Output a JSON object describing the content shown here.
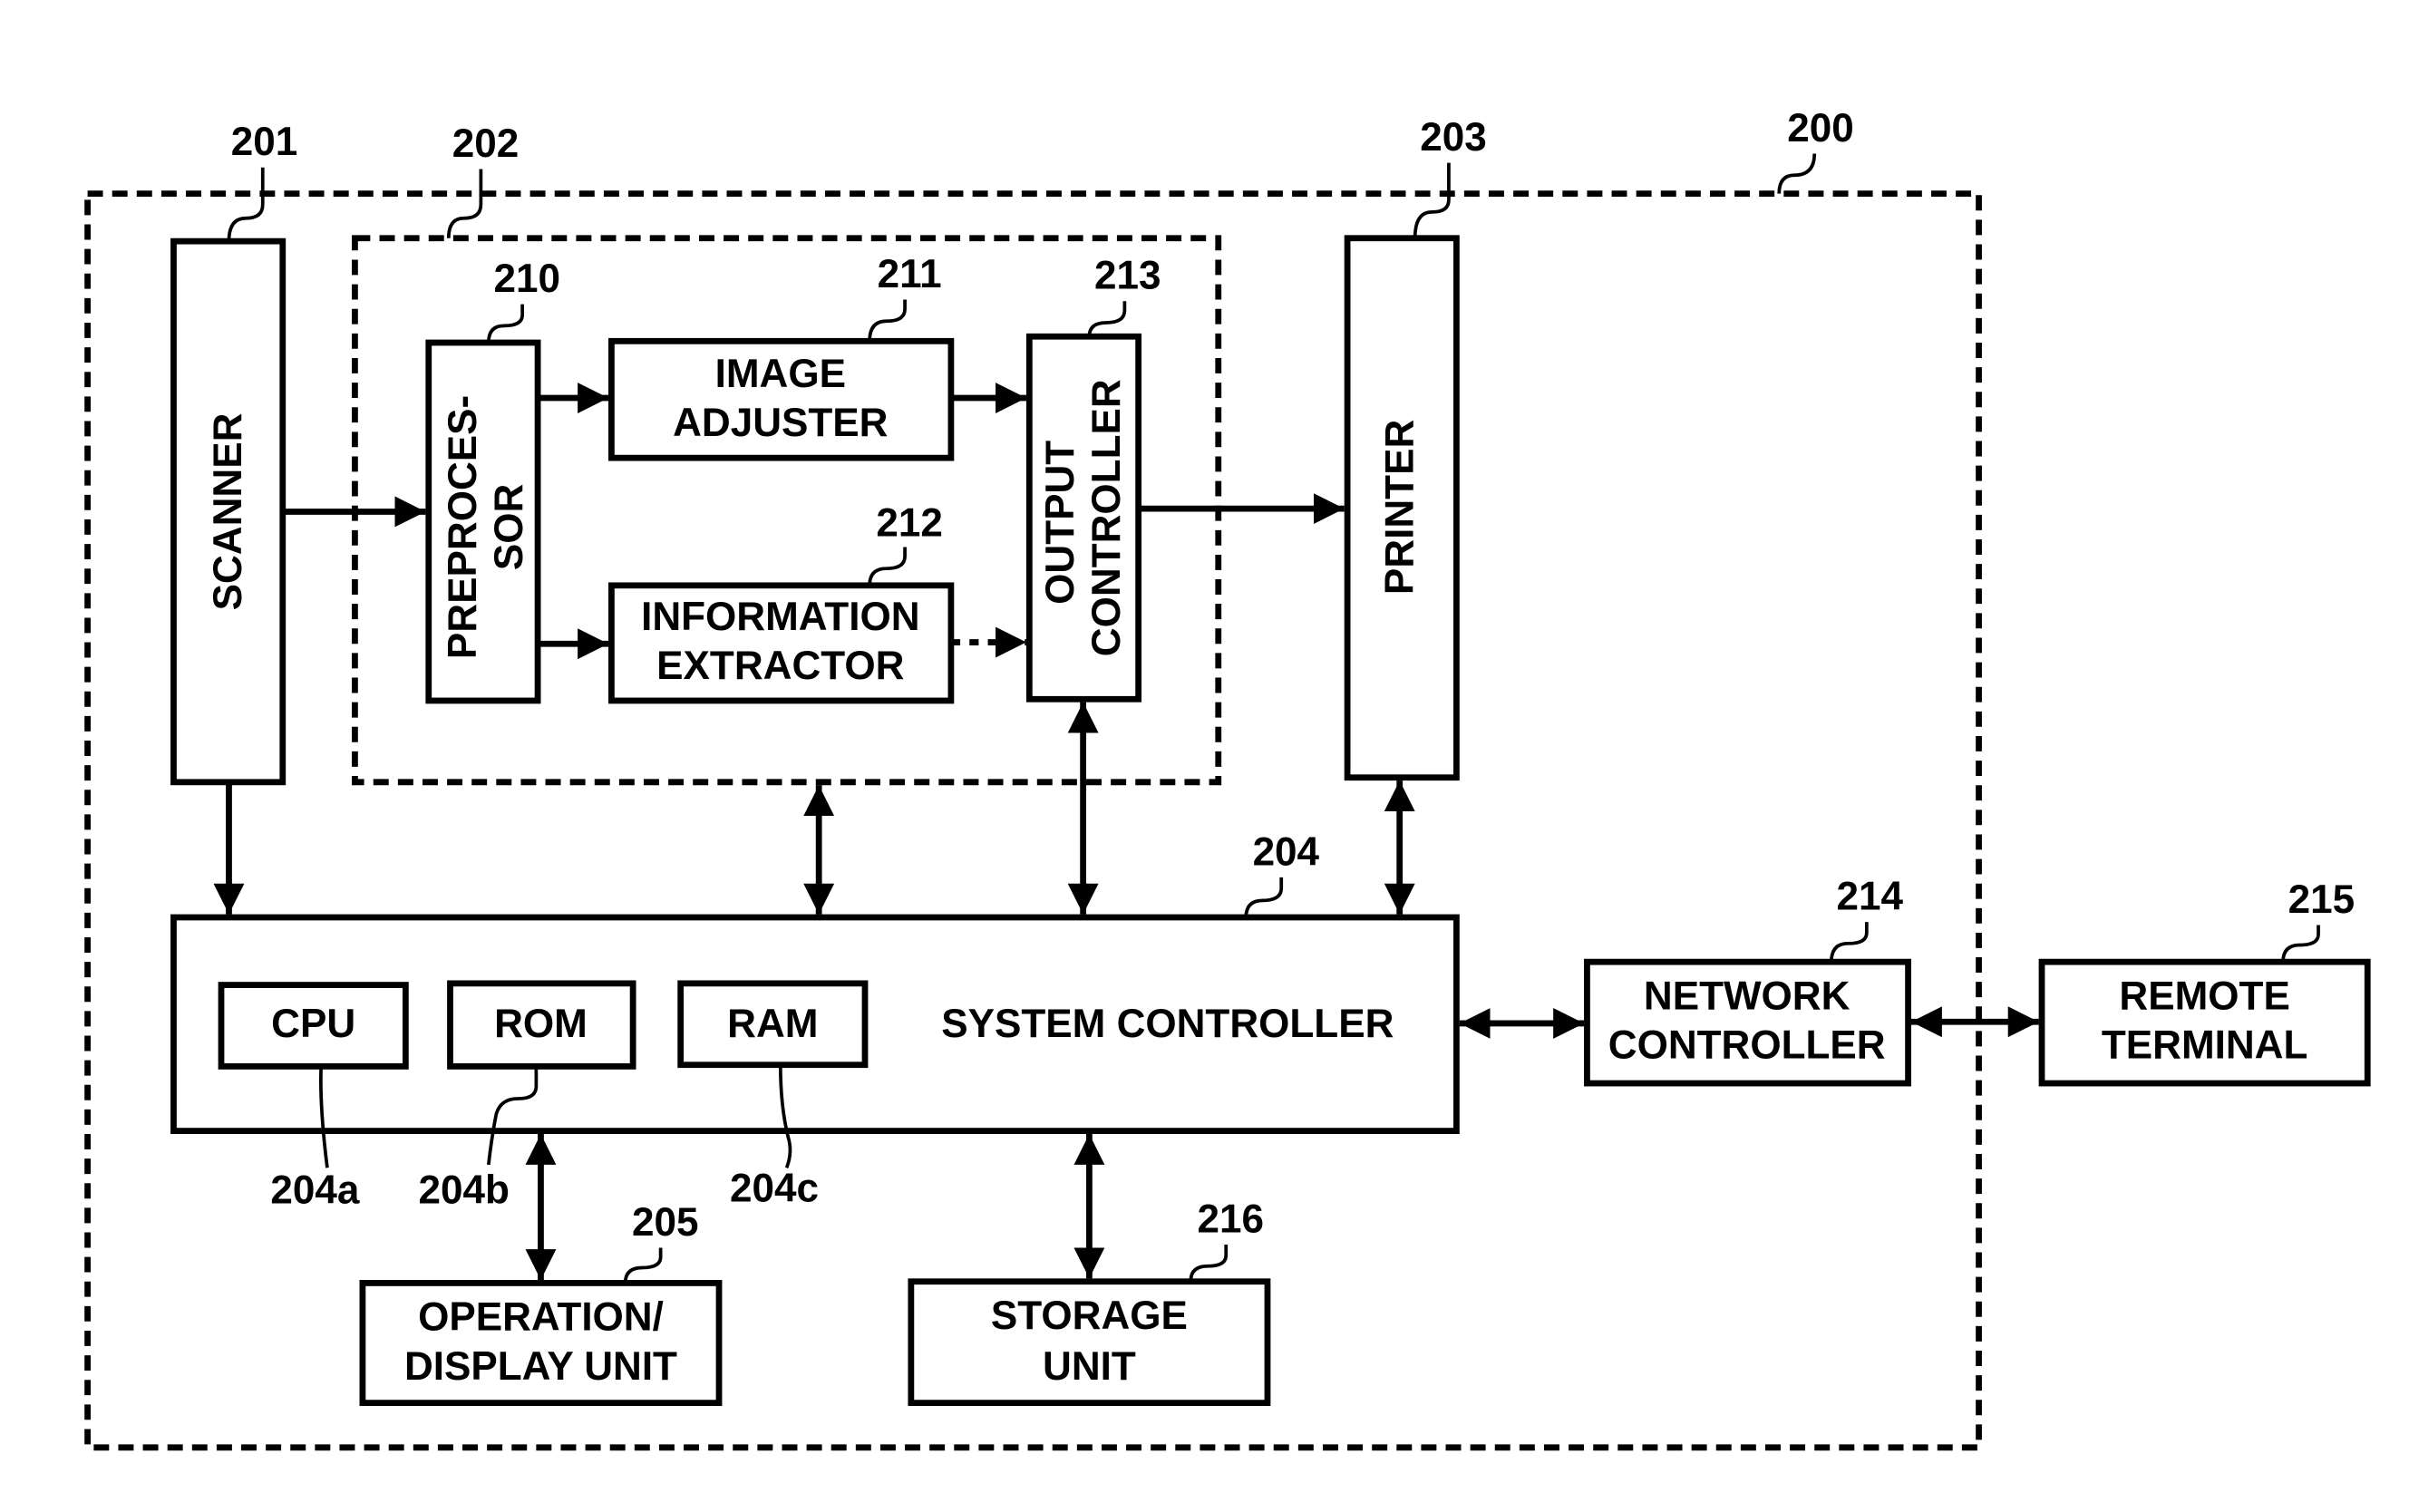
{
  "diagram": {
    "system": {
      "ref": "200"
    },
    "scanner": {
      "ref": "201",
      "label": "SCANNER"
    },
    "image_processor": {
      "ref": "202"
    },
    "printer": {
      "ref": "203",
      "label": "PRINTER"
    },
    "system_controller": {
      "ref": "204",
      "label": "SYSTEM CONTROLLER",
      "cpu": {
        "ref": "204a",
        "label": "CPU"
      },
      "rom": {
        "ref": "204b",
        "label": "ROM"
      },
      "ram": {
        "ref": "204c",
        "label": "RAM"
      }
    },
    "operation_display": {
      "ref": "205",
      "line1": "OPERATION/",
      "line2": "DISPLAY UNIT"
    },
    "preprocessor": {
      "ref": "210",
      "line1": "PREPROCES-",
      "line2": "SOR"
    },
    "image_adjuster": {
      "ref": "211",
      "line1": "IMAGE",
      "line2": "ADJUSTER"
    },
    "information_extractor": {
      "ref": "212",
      "line1": "INFORMATION",
      "line2": "EXTRACTOR"
    },
    "output_controller": {
      "ref": "213",
      "line1": "OUTPUT",
      "line2": "CONTROLLER"
    },
    "network_controller": {
      "ref": "214",
      "line1": "NETWORK",
      "line2": "CONTROLLER"
    },
    "remote_terminal": {
      "ref": "215",
      "line1": "REMOTE",
      "line2": "TERMINAL"
    },
    "storage_unit": {
      "ref": "216",
      "line1": "STORAGE",
      "line2": "UNIT"
    },
    "connections": [
      {
        "from": "SCANNER",
        "to": "PREPROCESSOR",
        "type": "one-way"
      },
      {
        "from": "SCANNER",
        "to": "SYSTEM CONTROLLER",
        "type": "one-way"
      },
      {
        "from": "PREPROCESSOR",
        "to": "IMAGE ADJUSTER",
        "type": "one-way"
      },
      {
        "from": "PREPROCESSOR",
        "to": "INFORMATION EXTRACTOR",
        "type": "one-way"
      },
      {
        "from": "IMAGE ADJUSTER",
        "to": "OUTPUT CONTROLLER",
        "type": "one-way"
      },
      {
        "from": "INFORMATION EXTRACTOR",
        "to": "OUTPUT CONTROLLER",
        "type": "one-way-dashed"
      },
      {
        "from": "OUTPUT CONTROLLER",
        "to": "PRINTER",
        "type": "one-way"
      },
      {
        "from": "IMAGE PROCESSOR (202)",
        "to": "SYSTEM CONTROLLER",
        "type": "two-way"
      },
      {
        "from": "OUTPUT CONTROLLER",
        "to": "SYSTEM CONTROLLER",
        "type": "two-way"
      },
      {
        "from": "PRINTER",
        "to": "SYSTEM CONTROLLER",
        "type": "two-way"
      },
      {
        "from": "SYSTEM CONTROLLER",
        "to": "NETWORK CONTROLLER",
        "type": "two-way"
      },
      {
        "from": "NETWORK CONTROLLER",
        "to": "REMOTE TERMINAL",
        "type": "two-way"
      },
      {
        "from": "SYSTEM CONTROLLER",
        "to": "OPERATION/DISPLAY UNIT",
        "type": "two-way"
      },
      {
        "from": "SYSTEM CONTROLLER",
        "to": "STORAGE UNIT",
        "type": "two-way"
      }
    ]
  }
}
